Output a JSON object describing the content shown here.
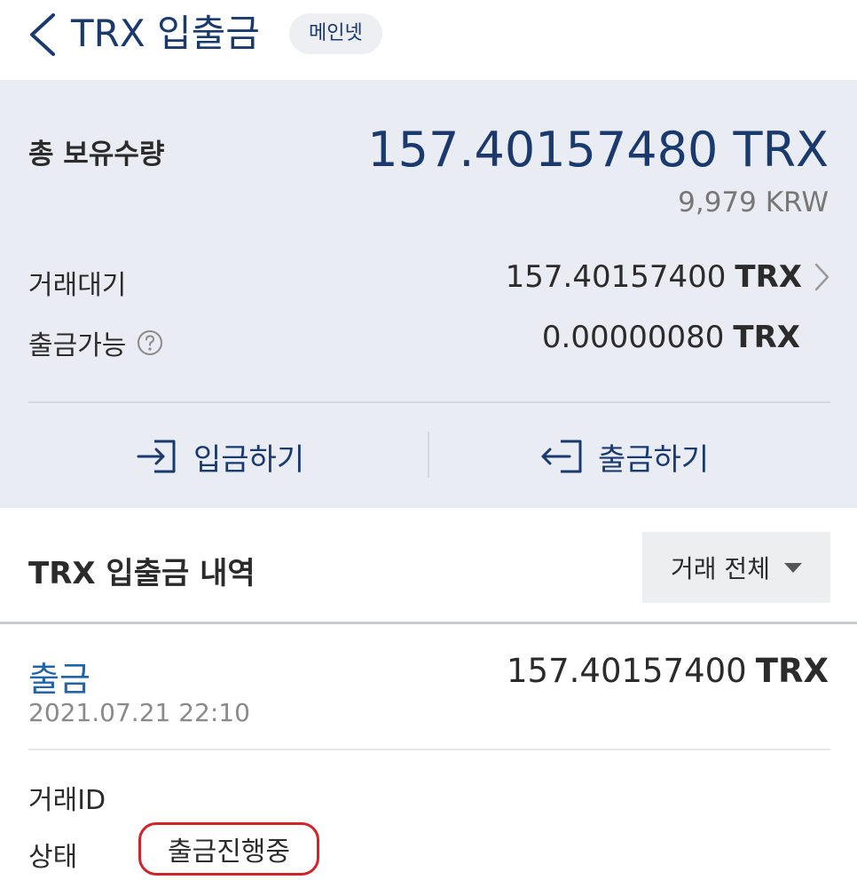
{
  "header": {
    "title": "TRX 입출금",
    "network_badge": "메인넷"
  },
  "summary": {
    "total_label": "총 보유수량",
    "total_amount": "157.40157480 TRX",
    "total_krw": "9,979 KRW",
    "pending_label": "거래대기",
    "pending_amount": "157.40157400",
    "pending_unit": "TRX",
    "withdrawable_label": "출금가능",
    "withdrawable_amount": "0.00000080",
    "withdrawable_unit": "TRX",
    "deposit_button": "입금하기",
    "withdraw_button": "출금하기"
  },
  "history": {
    "title": "TRX 입출금 내역",
    "filter_label": "거래 전체",
    "items": [
      {
        "type": "출금",
        "amount": "157.40157400",
        "unit": "TRX",
        "date": "2021.07.21 22:10",
        "txid_label": "거래ID",
        "status_label": "상태",
        "status_value": "출금진행중"
      }
    ]
  },
  "colors": {
    "brand_navy": "#1a3a6e",
    "summary_bg": "#e9ecf3",
    "link_blue": "#2264a8",
    "highlight_red": "#d0242b"
  },
  "icons": {
    "back": "chevron-left-icon",
    "help": "question-circle-icon",
    "detail": "chevron-right-icon",
    "deposit": "login-arrow-icon",
    "withdraw": "logout-arrow-icon",
    "dropdown": "caret-down-icon"
  }
}
